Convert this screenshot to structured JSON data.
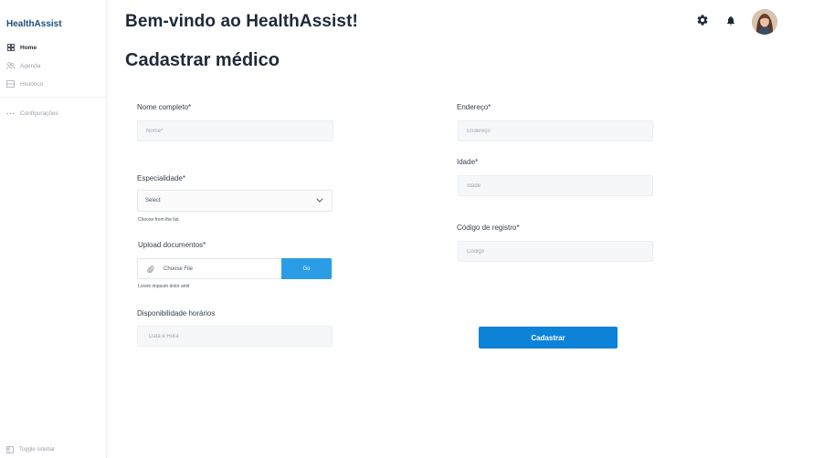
{
  "sidebar": {
    "brand": "HealthAssist",
    "items": [
      {
        "label": "Home",
        "icon": "grid-icon",
        "active": true
      },
      {
        "label": "Agenda",
        "icon": "users-icon",
        "active": false
      },
      {
        "label": "Histórico",
        "icon": "history-icon",
        "active": false
      }
    ],
    "settings_label": "Configurações",
    "toggle_label": "Toggle sidebar"
  },
  "header": {
    "welcome": "Bem-vindo ao HealthAssist!",
    "icons": [
      "gear-icon",
      "bell-icon"
    ],
    "avatar": "user-avatar"
  },
  "page": {
    "title": "Cadastrar médico"
  },
  "form": {
    "nome": {
      "label": "Nome completo*",
      "placeholder": "Nome*",
      "value": ""
    },
    "especialidade": {
      "label": "Especialidade*",
      "value": "Select",
      "hint": "Choose from the list."
    },
    "upload": {
      "label": "Upload documentos*",
      "file_label": "Choose File",
      "button": "Go",
      "hint": "Lorem impsum dolor amit"
    },
    "disponibilidade": {
      "label": "Disponibilidade horários",
      "placeholder": "Data e Hora",
      "value": ""
    },
    "endereco": {
      "label": "Endereço*",
      "placeholder": "Endereço",
      "value": ""
    },
    "idade": {
      "label": "Idade*",
      "placeholder": "Idade",
      "value": ""
    },
    "codigo": {
      "label": "Código de registro*",
      "placeholder": "Código",
      "value": ""
    },
    "submit": "Cadastrar"
  },
  "colors": {
    "brand": "#1d4e7a",
    "primary_button": "#0d83d8",
    "go_button": "#2b9de6",
    "input_bg": "#f6f7f9"
  }
}
